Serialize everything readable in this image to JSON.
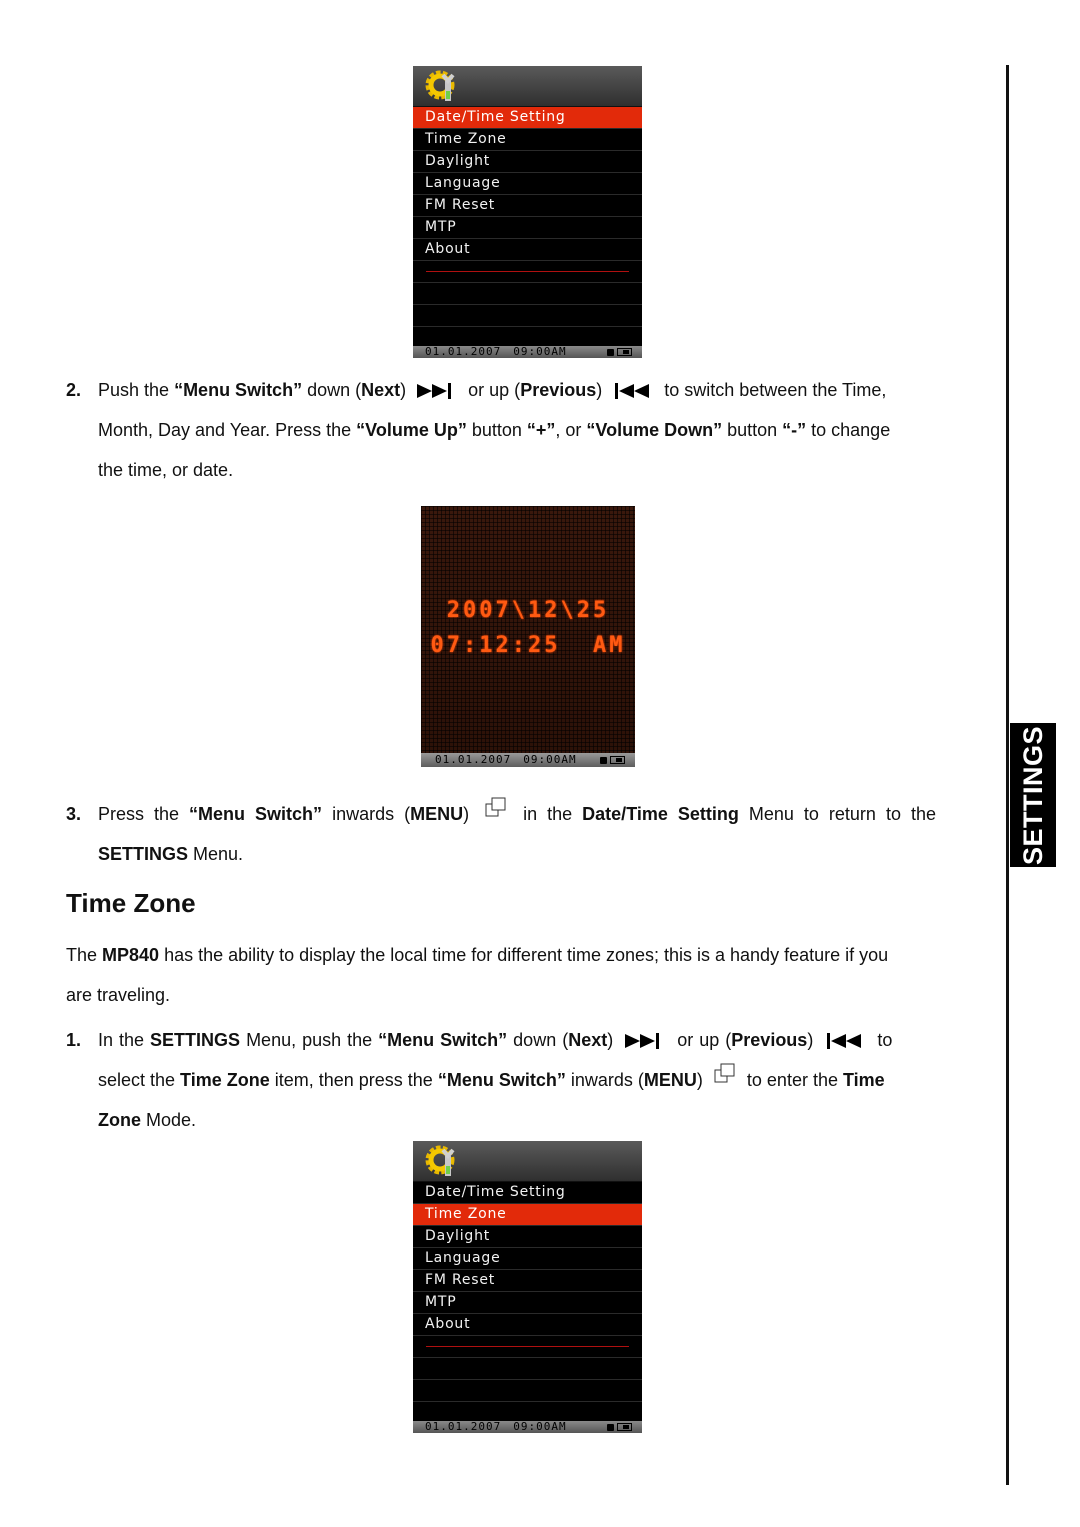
{
  "side_tab": {
    "label": "SETTINGS"
  },
  "menu_items": [
    "Date/Time Setting",
    "Time Zone",
    "Daylight",
    "Language",
    "FM Reset",
    "MTP",
    "About"
  ],
  "screen1": {
    "selected_index": 0
  },
  "screen3": {
    "selected_index": 1
  },
  "status_bar": {
    "date": "01.01.2007",
    "time": "09:00AM"
  },
  "clock_screen": {
    "date_line": "2007\\12\\25",
    "time_line": "07:12:25  AM",
    "accent_color": "#ff5a12"
  },
  "colors": {
    "selected_bg": "#e22a0a",
    "screen_bg": "#000000"
  },
  "step2": {
    "num": "2.",
    "t1": "Push the ",
    "b1": "“Menu Switch”",
    "t2": " down (",
    "b2": "Next",
    "t3": ")",
    "icon_next": "skip-next-icon",
    "t4": " or up (",
    "b3": "Previous",
    "t5": ")",
    "icon_prev": "skip-previous-icon",
    "t6": " to switch between the Time,",
    "line2_t1": "Month, Day and Year. Press the ",
    "line2_b1": "“Volume Up”",
    "line2_t2": " button ",
    "line2_b2": "“+”",
    "line2_t3": ", or ",
    "line2_b3": "“Volume Down”",
    "line2_t4": " button ",
    "line2_b4": "“-”",
    "line2_t5": " to change",
    "line3": "the time, or date."
  },
  "step3": {
    "num": "3.",
    "t1": "Press the ",
    "b1": "“Menu Switch”",
    "t2": " inwards (",
    "b2": "MENU",
    "t3": ")",
    "icon_menu": "menu-icon",
    "t4": " in the ",
    "b3": "Date/Time Setting",
    "t5": " Menu to return to the",
    "line2_b1": "SETTINGS",
    "line2_t1": " Menu."
  },
  "section": {
    "title": "Time Zone",
    "intro_t1": "The ",
    "intro_b1": "MP840",
    "intro_t2": " has the ability to display the local time for different time zones; this is a handy feature if you",
    "intro_line2": "are traveling."
  },
  "step1": {
    "num": "1.",
    "t1": "In the ",
    "b1": "SETTINGS",
    "t2": " Menu, push the ",
    "b2": "“Menu Switch”",
    "t3": " down (",
    "b3": "Next",
    "t4": ")",
    "t5": " or up (",
    "b4": "Previous",
    "t6": ")",
    "t7": " to",
    "line2_t1": "select the ",
    "line2_b1": "Time Zone",
    "line2_t2": " item, then press the ",
    "line2_b2": "“Menu Switch”",
    "line2_t3": " inwards (",
    "line2_b3": "MENU",
    "line2_t4": ")",
    "line2_t5": " to enter the ",
    "line2_b4": "Time",
    "line3_b1": "Zone",
    "line3_t1": " Mode."
  }
}
